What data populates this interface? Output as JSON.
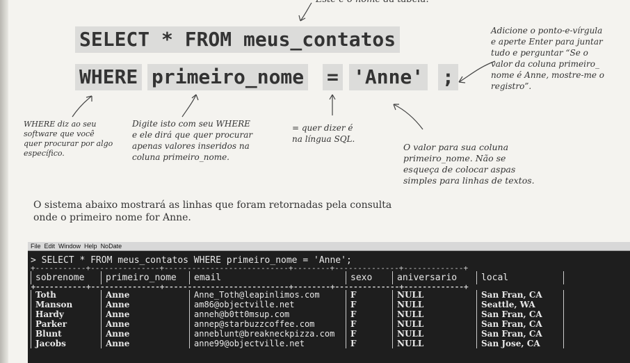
{
  "annotations": {
    "table_name": "Este é o nome da tabela.",
    "semicolon": [
      "Adicione o ponto-e-vírgula",
      "e aperte Enter para juntar",
      "tudo e perguntar “Se o",
      "valor da coluna primeiro_",
      "nome é Anne, mostre-me o",
      "registro”."
    ],
    "where": [
      "WHERE diz ao seu",
      "software que você",
      "quer procurar por algo",
      "específico."
    ],
    "column": [
      "Digite isto com seu WHERE",
      "e ele dirá que quer procurar",
      "apenas valores inseridos na",
      "coluna primeiro_nome."
    ],
    "equals": [
      "= quer dizer é",
      "na língua SQL."
    ],
    "value": [
      "O valor para sua coluna",
      "primeiro_nome. Não se",
      "esqueça de colocar aspas",
      "simples para linhas de textos."
    ]
  },
  "code": {
    "line1": "SELECT * FROM meus_contatos",
    "where": "WHERE",
    "column": "primeiro_nome",
    "equals": "=",
    "value": "'Anne'",
    "semicolon": ";"
  },
  "prose": [
    "O sistema abaixo mostrará as linhas que foram retornadas pela consulta",
    "onde o primeiro nome for Anne."
  ],
  "terminal": {
    "menu": [
      "File",
      "Edit",
      "Window",
      "Help",
      "NoDate"
    ],
    "query": "> SELECT * FROM meus_contatos WHERE primeiro_nome = 'Anne';",
    "separator": "+-----------+---------------+---------------------------+--------+--------------+-------------+",
    "columns": [
      "sobrenome",
      "primeiro_nome",
      "email",
      "sexo",
      "aniversario",
      "local"
    ],
    "rows": [
      [
        "Toth",
        "Anne",
        "Anne_Toth@leapinlimos.com",
        "F",
        "NULL",
        "San Fran, CA"
      ],
      [
        "Manson",
        "Anne",
        "am86@objectville.net",
        "F",
        "NULL",
        "Seattle, WA"
      ],
      [
        "Hardy",
        "Anne",
        "anneh@b0tt0msup.com",
        "F",
        "NULL",
        "San Fran, CA"
      ],
      [
        "Parker",
        "Anne",
        "annep@starbuzzcoffee.com",
        "F",
        "NULL",
        "San Fran, CA"
      ],
      [
        "Blunt",
        "Anne",
        "anneblunt@breakneckpizza.com",
        "F",
        "NULL",
        "San Fran, CA"
      ],
      [
        "Jacobs",
        "Anne",
        "anne99@objectville.net",
        "F",
        "NULL",
        "San Jose, CA"
      ]
    ]
  }
}
